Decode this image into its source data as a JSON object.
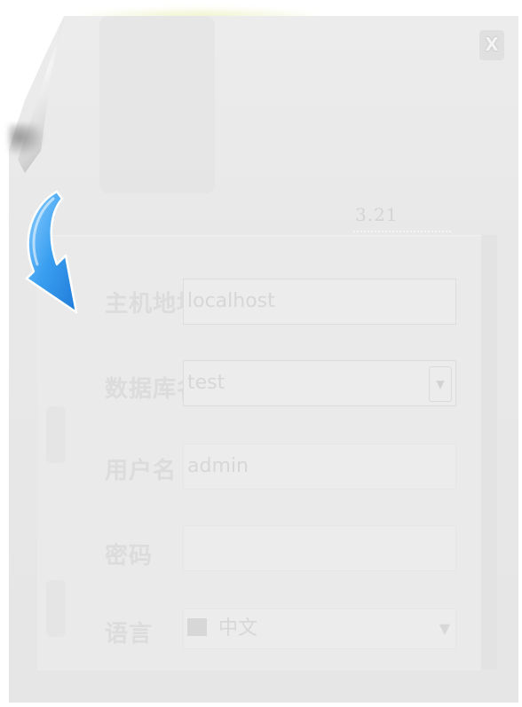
{
  "dialog": {
    "close_label": "X",
    "version": "3.21"
  },
  "form": {
    "host": {
      "label": "主机地址",
      "value": "localhost"
    },
    "database": {
      "label": "数据库名",
      "value": "test"
    },
    "username": {
      "label": "用户名",
      "value": "admin"
    },
    "password": {
      "label": "密码",
      "value": ""
    },
    "language": {
      "label": "语言",
      "value": "中文"
    }
  },
  "colors": {
    "arrow": "#3a9ff0",
    "sheet": "#e8e8e8",
    "faded_text": "#d7d7d7"
  },
  "icons": {
    "arrow": "curved-down-arrow-icon",
    "close": "close-icon",
    "select": "chevron-down-icon",
    "flag": "flag-icon"
  }
}
